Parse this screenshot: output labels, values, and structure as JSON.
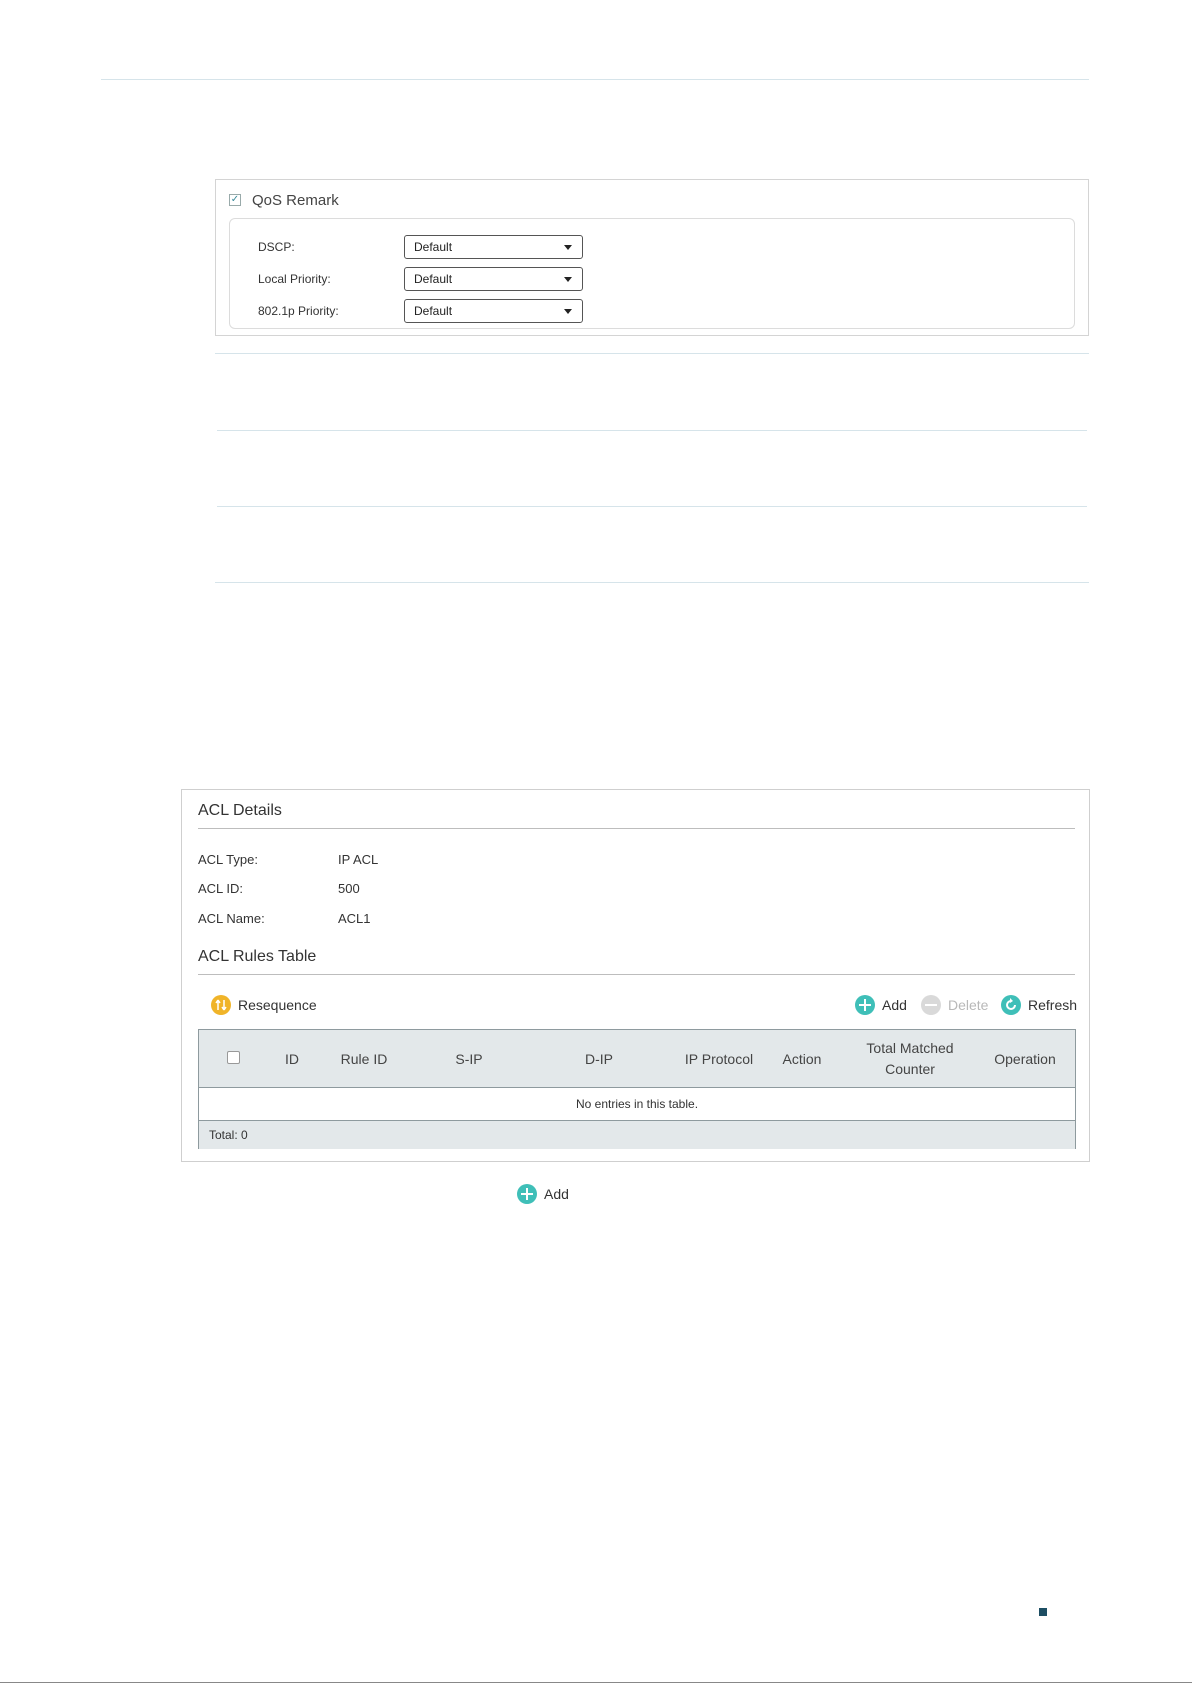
{
  "qos_remark": {
    "checked": true,
    "check_glyph": "✓",
    "title": "QoS Remark",
    "fields": [
      {
        "label": "DSCP:",
        "value": "Default"
      },
      {
        "label": "Local Priority:",
        "value": "Default"
      },
      {
        "label": "802.1p Priority:",
        "value": "Default"
      }
    ]
  },
  "acl_details": {
    "title": "ACL Details",
    "acl_type_label": "ACL Type:",
    "acl_type_value": "IP ACL",
    "acl_id_label": "ACL ID:",
    "acl_id_value": "500",
    "acl_name_label": "ACL Name:",
    "acl_name_value": "ACL1"
  },
  "rules_table": {
    "title": "ACL Rules Table",
    "resequence_label": "Resequence",
    "add_label": "Add",
    "delete_label": "Delete",
    "refresh_label": "Refresh",
    "columns": [
      "ID",
      "Rule ID",
      "S-IP",
      "D-IP",
      "IP Protocol",
      "Action",
      "Total Matched",
      "Counter",
      "Operation"
    ],
    "empty_message": "No entries in this table.",
    "total_label": "Total: 0"
  },
  "bottom_add_label": "Add",
  "colors": {
    "teal_icon": "#3fbfb8",
    "resequence_icon": "#f0b429",
    "disabled_icon": "#d9d9d9",
    "page_mark": "#1d4e63"
  },
  "icons": {
    "resequence": "resequence-icon",
    "add": "plus-circle-icon",
    "delete": "minus-circle-icon",
    "refresh": "refresh-icon"
  }
}
